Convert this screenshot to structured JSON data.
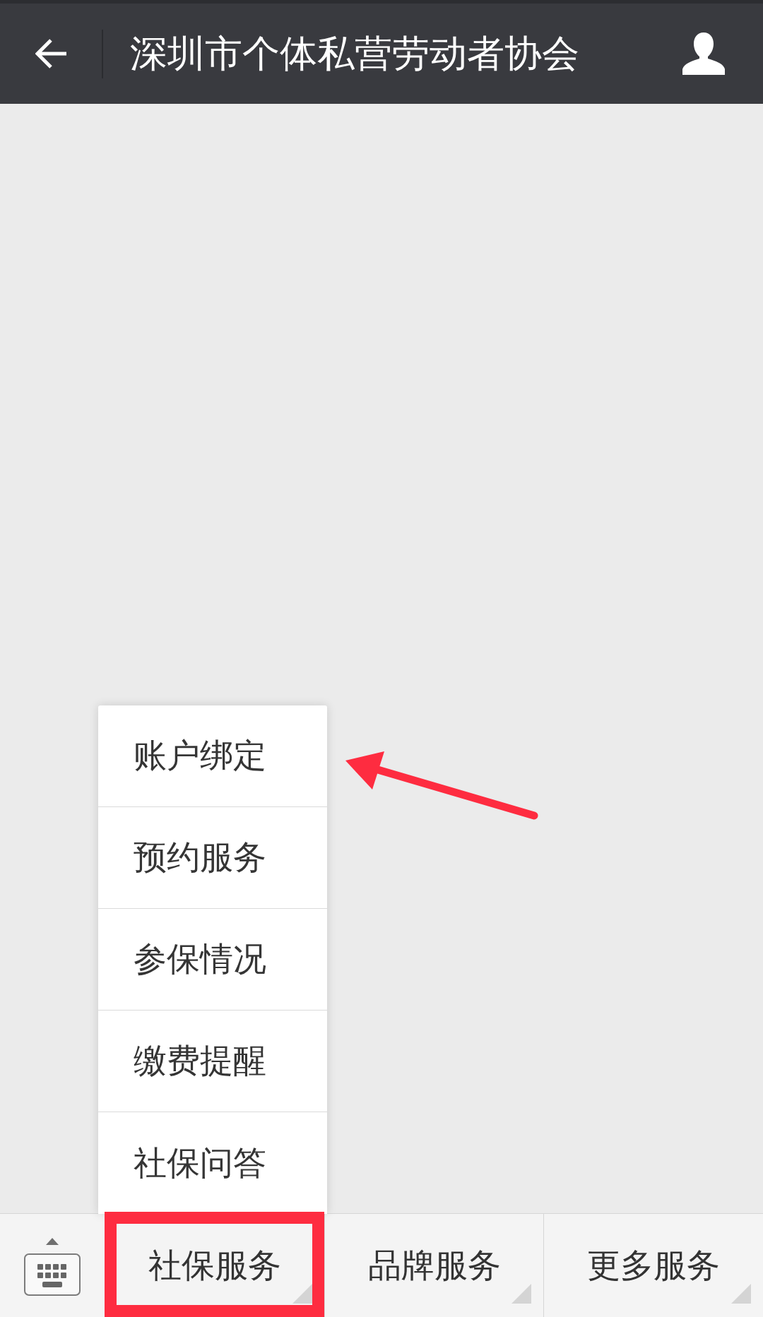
{
  "header": {
    "title": "深圳市个体私营劳动者协会"
  },
  "menu_bar": {
    "tabs": [
      {
        "label": "社保服务",
        "expanded": true,
        "highlighted": true,
        "menu": [
          "账户绑定",
          "预约服务",
          "参保情况",
          "缴费提醒",
          "社保问答"
        ]
      },
      {
        "label": "品牌服务",
        "expanded": false,
        "highlighted": false
      },
      {
        "label": "更多服务",
        "expanded": false,
        "highlighted": false
      }
    ]
  }
}
